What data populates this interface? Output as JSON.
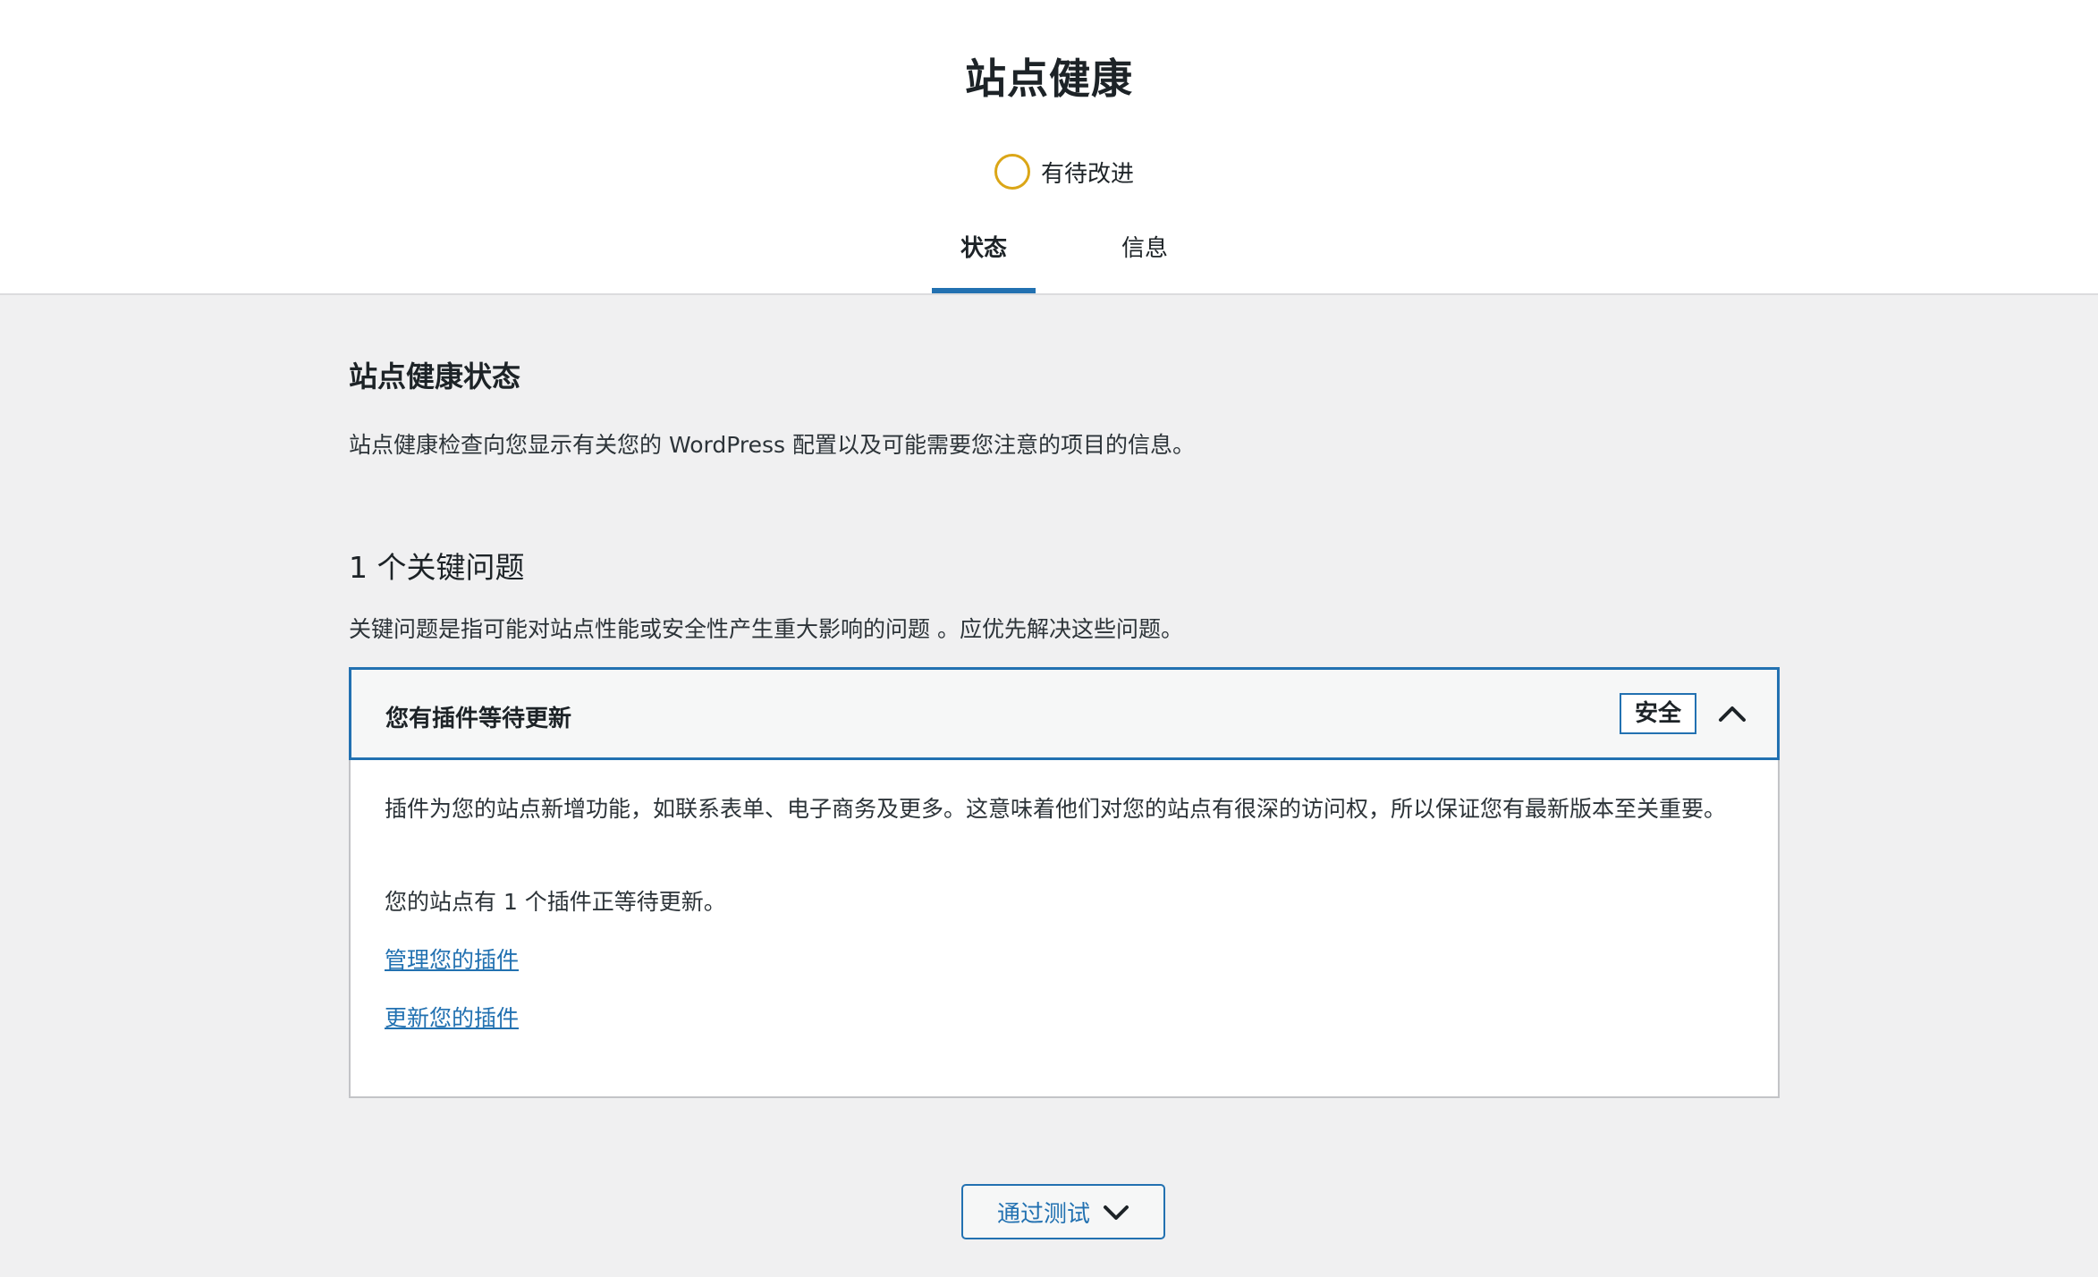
{
  "header": {
    "title": "站点健康",
    "score_label": "有待改进",
    "score_color": "#dba617",
    "tabs": [
      {
        "label": "状态",
        "active": true
      },
      {
        "label": "信息",
        "active": false
      }
    ]
  },
  "status_section": {
    "title": "站点健康状态",
    "description": "站点健康检查向您显示有关您的 WordPress 配置以及可能需要您注意的项目的信息。"
  },
  "critical_issues": {
    "title": "1 个关键问题",
    "description": "关键问题是指可能对站点性能或安全性产生重大影响的问题 。应优先解决这些问题。",
    "items": [
      {
        "title": "您有插件等待更新",
        "badge": "安全",
        "expanded": true,
        "paragraphs": [
          "插件为您的站点新增功能，如联系表单、电子商务及更多。这意味着他们对您的站点有很深的访问权，所以保证您有最新版本至关重要。",
          "您的站点有 1 个插件正等待更新。"
        ],
        "links": [
          "管理您的插件",
          "更新您的插件"
        ]
      }
    ]
  },
  "passed_tests_button": {
    "label": "通过测试",
    "icon": "chevron-down-icon"
  },
  "colors": {
    "accent": "#2271b1",
    "background": "#f0f0f1"
  }
}
